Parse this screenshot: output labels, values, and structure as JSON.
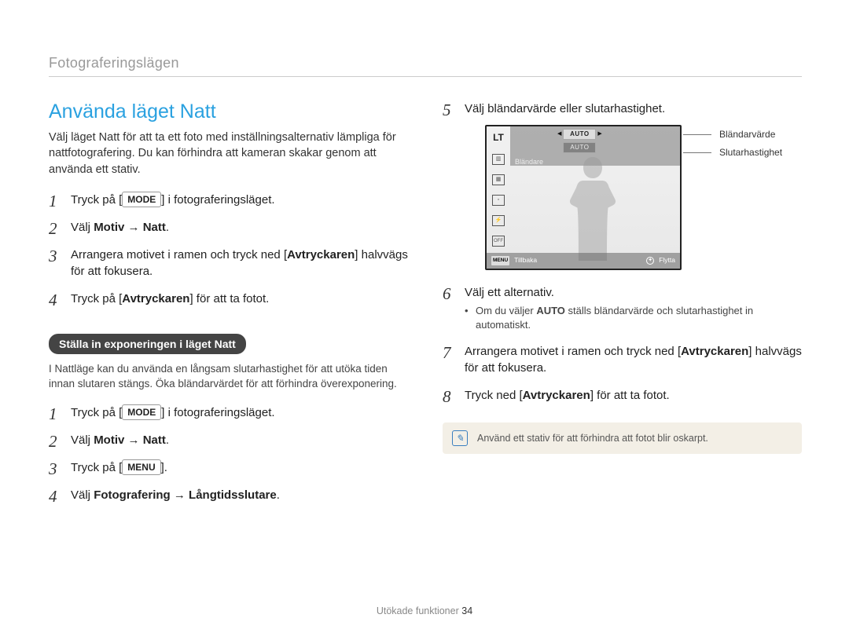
{
  "breadcrumb": "Fotograferingslägen",
  "title": "Använda läget Natt",
  "intro": "Välj läget Natt för att ta ett foto med inställningsalternativ lämpliga för nattfotografering. Du kan förhindra att kameran skakar genom att använda ett stativ.",
  "stepsA": {
    "s1_a": "Tryck på [",
    "s1_key": "MODE",
    "s1_b": "] i fotograferingsläget.",
    "s2_a": "Välj ",
    "s2_boldA": "Motiv",
    "s2_arrow": " → ",
    "s2_boldB": "Natt",
    "s2_end": ".",
    "s3_a": "Arrangera motivet i ramen och tryck ned [",
    "s3_bold": "Avtryckaren",
    "s3_b": "] halvvägs för att fokusera.",
    "s4_a": "Tryck på [",
    "s4_bold": "Avtryckaren",
    "s4_b": "] för att ta fotot."
  },
  "subhead": "Ställa in exponeringen i läget Natt",
  "subintro": "I Nattläge kan du använda en långsam slutarhastighet för att utöka tiden innan slutaren stängs. Öka bländarvärdet för att förhindra överexponering.",
  "stepsB": {
    "s1_a": "Tryck på [",
    "s1_key": "MODE",
    "s1_b": "] i fotograferingsläget.",
    "s2_a": "Välj ",
    "s2_boldA": "Motiv",
    "s2_arrow": " → ",
    "s2_boldB": "Natt",
    "s2_end": ".",
    "s3_a": "Tryck på [",
    "s3_key": "MENU",
    "s3_b": "].",
    "s4_a": "Välj ",
    "s4_boldA": "Fotografering",
    "s4_arrow": " → ",
    "s4_boldB": "Långtidsslutare",
    "s4_end": "."
  },
  "right": {
    "s5": "Välj bländarvärde eller slutarhastighet.",
    "s6": "Välj ett alternativ.",
    "s6_note_a": "Om du väljer ",
    "s6_note_bold": "AUTO",
    "s6_note_b": " ställs bländarvärde och slutarhastighet in automatiskt.",
    "s7_a": "Arrangera motivet i ramen och tryck ned [",
    "s7_bold": "Avtryckaren",
    "s7_b": "] halvvägs för att fokusera.",
    "s8_a": "Tryck ned [",
    "s8_bold": "Avtryckaren",
    "s8_b": "] för att ta fotot."
  },
  "lcd": {
    "lt": "LT",
    "row1_label": "",
    "row1_value": "AUTO",
    "row2_label": "",
    "row2_value": "AUTO",
    "row3_label": "Bländare",
    "back_key": "MENU",
    "back_label": "Tillbaka",
    "move_label": "Flytta"
  },
  "callout1": "Bländarvärde",
  "callout2": "Slutarhastighet",
  "tip": "Använd ett stativ för att förhindra att fotot blir oskarpt.",
  "footer_label": "Utökade funktioner",
  "footer_page": "34"
}
